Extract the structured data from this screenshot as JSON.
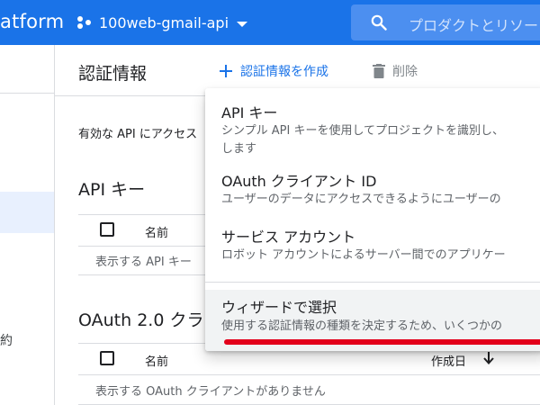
{
  "topbar": {
    "brand": "atform",
    "project_name": "100web-gmail-api",
    "search_placeholder": "プロダクトとリソー"
  },
  "leftnav": {
    "truncated_label": "約"
  },
  "header": {
    "title": "認証情報",
    "create_label": "認証情報を作成",
    "delete_label": "削除"
  },
  "main": {
    "description": "有効な API にアクセス",
    "api_keys": {
      "title": "API キー",
      "col_name": "名前",
      "empty": "表示する API キー"
    },
    "oauth": {
      "title": "OAuth 2.0 クラ",
      "col_name": "名前",
      "col_created": "作成日",
      "empty": "表示する OAuth クライアントがありません"
    }
  },
  "menu": {
    "items": [
      {
        "label": "API キー",
        "description": "シンプル API キーを使用してプロジェクトを識別し、\nします"
      },
      {
        "label": "OAuth クライアント ID",
        "description": "ユーザーのデータにアクセスできるようにユーザーの"
      },
      {
        "label": "サービス アカウント",
        "description": "ロボット アカウントによるサーバー間でのアプリケー"
      },
      {
        "label": "ウィザードで選択",
        "description": "使用する認証情報の種類を決定するため、いくつかの"
      }
    ]
  },
  "colors": {
    "primary": "#1a73e8",
    "highlight_underline": "#e3001b"
  }
}
